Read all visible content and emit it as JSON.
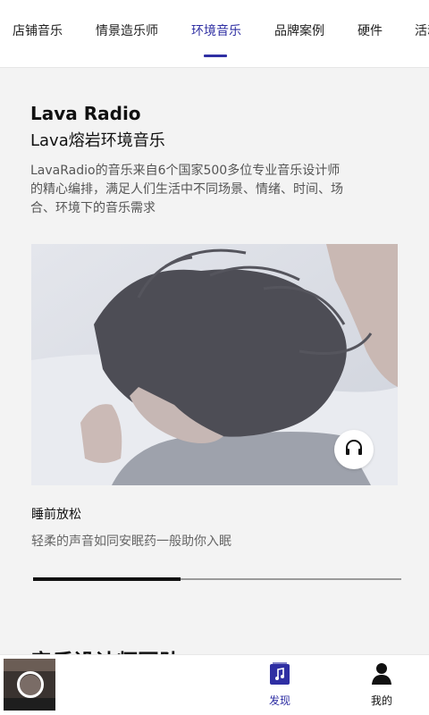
{
  "tabs": [
    {
      "label": "店铺音乐",
      "active": false
    },
    {
      "label": "情景造乐师",
      "active": false
    },
    {
      "label": "环境音乐",
      "active": true
    },
    {
      "label": "品牌案例",
      "active": false
    },
    {
      "label": "硬件",
      "active": false
    },
    {
      "label": "活动",
      "active": false
    }
  ],
  "brand": {
    "title": "Lava Radio",
    "subtitle": "Lava熔岩环境音乐",
    "description": "LavaRadio的音乐来自6个国家500多位专业音乐设计师的精心编排，满足人们生活中不同场景、情绪、时间、场合、环境下的音乐需求"
  },
  "playlist": {
    "title": "睡前放松",
    "description": "轻柔的声音如同安眠药一般助你入眠",
    "play_icon": "headphones-icon",
    "progress": 0.4
  },
  "section": {
    "title": "音乐设计师团队"
  },
  "bottom_nav": {
    "discover_label": "发现",
    "discover_icon": "music-note-icon",
    "me_label": "我的",
    "me_icon": "person-icon"
  },
  "colors": {
    "accent": "#2f2fa3",
    "background": "#f3f3f3"
  }
}
